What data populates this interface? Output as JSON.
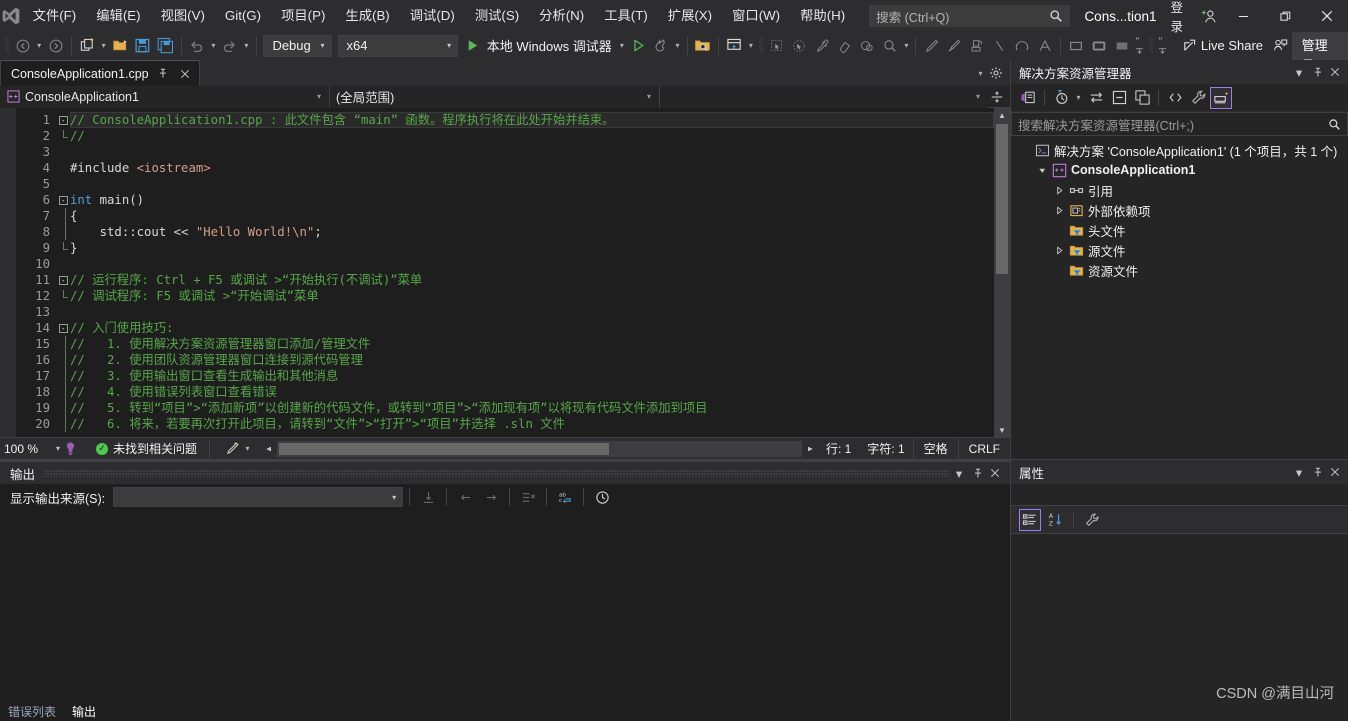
{
  "titlebar": {
    "logo_icon": "visual-studio-logo-icon",
    "menus": [
      {
        "label": "文件(F)"
      },
      {
        "label": "编辑(E)"
      },
      {
        "label": "视图(V)"
      },
      {
        "label": "Git(G)"
      },
      {
        "label": "项目(P)"
      },
      {
        "label": "生成(B)"
      },
      {
        "label": "调试(D)"
      },
      {
        "label": "测试(S)"
      },
      {
        "label": "分析(N)"
      },
      {
        "label": "工具(T)"
      },
      {
        "label": "扩展(X)"
      },
      {
        "label": "窗口(W)"
      },
      {
        "label": "帮助(H)"
      }
    ],
    "search_placeholder": "搜索 (Ctrl+Q)",
    "search_icon": "search-icon",
    "window_title": "Cons...tion1",
    "signin_label": "登录",
    "signin_icon": "add-person-icon",
    "minimize": "—",
    "restore": "❐",
    "close": "✕"
  },
  "toolbar": {
    "back_icon": "navigate-back-icon",
    "forward_icon": "navigate-forward-icon",
    "new_project_icon": "new-project-icon",
    "open_icon": "open-file-icon",
    "save_icon": "save-icon",
    "save_all_icon": "save-all-icon",
    "undo_icon": "undo-icon",
    "redo_icon": "redo-icon",
    "config_value": "Debug",
    "platform_value": "x64",
    "run_label": "本地 Windows 调试器",
    "run_icon": "play-icon",
    "start_no_debug_icon": "play-outline-icon",
    "hot_reload_icon": "hot-reload-icon",
    "folder_search_icon": "folder-search-icon",
    "window_layout_icon": "window-layout-icon",
    "select_icon": "select-tool-icon",
    "pointer_icon": "pointer-tool-icon",
    "eyedropper_icon": "eyedropper-icon",
    "eraser_icon": "eraser-icon",
    "fill_icon": "fill-icon",
    "zoom_icon": "magnifier-icon",
    "pencil_icon": "pencil-icon",
    "brush_icon": "brush-icon",
    "stamp_icon": "stamp-icon",
    "line_icon": "line-icon",
    "arc_icon": "arc-icon",
    "text_icon": "text-tool-icon",
    "rect1_icon": "rectangle-icon",
    "rect2_icon": "rounded-rectangle-icon",
    "rect3_icon": "filled-rectangle-icon",
    "quote_left_icon": "quote-left-icon",
    "quote_right_icon": "quote-right-icon",
    "live_share_label": "Live Share",
    "live_share_icon": "live-share-icon",
    "feedback_icon": "feedback-icon",
    "admin_label": "管理员"
  },
  "editor": {
    "tab_label": "ConsoleApplication1.cpp",
    "tab_pin_icon": "pin-icon",
    "tab_close_icon": "close-icon",
    "tab_settings_icon": "gear-icon",
    "tab_chevron_icon": "chevron-down-icon",
    "scope_left": "ConsoleApplication1",
    "scope_left_icon": "cpp-project-icon",
    "scope_right": "(全局范围)",
    "nav_split_icon": "split-window-icon",
    "code_lines": [
      {
        "n": 1,
        "fold": "open",
        "segs": [
          {
            "c": "cmt",
            "t": "// ConsoleApplication1.cpp : 此文件包含 “main” 函数。程序执行将在此处开始并结束。"
          }
        ]
      },
      {
        "n": 2,
        "fold": "end",
        "segs": [
          {
            "c": "cmt",
            "t": "//"
          }
        ]
      },
      {
        "n": 3,
        "fold": "",
        "segs": []
      },
      {
        "n": 4,
        "fold": "",
        "segs": [
          {
            "c": "pp",
            "t": "#include "
          },
          {
            "c": "str",
            "t": "<iostream>"
          }
        ]
      },
      {
        "n": 5,
        "fold": "",
        "segs": []
      },
      {
        "n": 6,
        "fold": "open",
        "segs": [
          {
            "c": "kw",
            "t": "int"
          },
          {
            "c": "id",
            "t": " main()"
          }
        ]
      },
      {
        "n": 7,
        "fold": "bar",
        "segs": [
          {
            "c": "id",
            "t": "{"
          }
        ]
      },
      {
        "n": 8,
        "fold": "dbar",
        "segs": [
          {
            "c": "id",
            "t": "    std::cout << "
          },
          {
            "c": "str",
            "t": "\"Hello World!\\n\""
          },
          {
            "c": "id",
            "t": ";"
          }
        ]
      },
      {
        "n": 9,
        "fold": "end",
        "segs": [
          {
            "c": "id",
            "t": "}"
          }
        ]
      },
      {
        "n": 10,
        "fold": "",
        "segs": []
      },
      {
        "n": 11,
        "fold": "open",
        "segs": [
          {
            "c": "cmt",
            "t": "// 运行程序: Ctrl + F5 或调试 >“开始执行(不调试)”菜单"
          }
        ]
      },
      {
        "n": 12,
        "fold": "end",
        "segs": [
          {
            "c": "cmt",
            "t": "// 调试程序: F5 或调试 >“开始调试”菜单"
          }
        ]
      },
      {
        "n": 13,
        "fold": "",
        "segs": []
      },
      {
        "n": 14,
        "fold": "open",
        "segs": [
          {
            "c": "cmt",
            "t": "// 入门使用技巧: "
          }
        ]
      },
      {
        "n": 15,
        "fold": "bar",
        "segs": [
          {
            "c": "cmt",
            "t": "//   1. 使用解决方案资源管理器窗口添加/管理文件"
          }
        ]
      },
      {
        "n": 16,
        "fold": "bar",
        "segs": [
          {
            "c": "cmt",
            "t": "//   2. 使用团队资源管理器窗口连接到源代码管理"
          }
        ]
      },
      {
        "n": 17,
        "fold": "bar",
        "segs": [
          {
            "c": "cmt",
            "t": "//   3. 使用输出窗口查看生成输出和其他消息"
          }
        ]
      },
      {
        "n": 18,
        "fold": "bar",
        "segs": [
          {
            "c": "cmt",
            "t": "//   4. 使用错误列表窗口查看错误"
          }
        ]
      },
      {
        "n": 19,
        "fold": "bar",
        "segs": [
          {
            "c": "cmt",
            "t": "//   5. 转到“项目”>“添加新项”以创建新的代码文件，或转到“项目”>“添加现有项”以将现有代码文件添加到项目"
          }
        ]
      },
      {
        "n": 20,
        "fold": "bar",
        "segs": [
          {
            "c": "cmt",
            "t": "//   6. 将来，若要再次打开此项目，请转到“文件”>“打开”>“项目”并选择 .sln 文件"
          }
        ]
      }
    ],
    "status": {
      "zoom": "100 %",
      "zoom_caret_icon": "chevron-down-icon",
      "intellisense_icon": "intellisense-icon",
      "issues_text": "未找到相关问题",
      "issues_ok_icon": "check-circle-icon",
      "pen_icon": "pen-tool-icon",
      "pen_caret_icon": "chevron-down-icon",
      "line_label": "行: 1",
      "col_label": "字符: 1",
      "spaces_label": "空格",
      "eol_label": "CRLF"
    }
  },
  "output": {
    "title": "输出",
    "chevron_icon": "chevron-down-icon",
    "pin_icon": "pin-icon",
    "close_icon": "close-icon",
    "source_label": "显示输出来源(S):",
    "source_value": "",
    "source_caret_icon": "chevron-down-icon",
    "buttons": [
      {
        "icon": "find-message-icon"
      },
      {
        "icon": "go-previous-icon"
      },
      {
        "icon": "go-next-icon"
      },
      {
        "icon": "clear-all-icon"
      },
      {
        "icon": "word-wrap-icon"
      },
      {
        "icon": "toggle-timestamp-icon"
      }
    ],
    "bottom_tabs": [
      {
        "label": "错误列表",
        "active": false
      },
      {
        "label": "输出",
        "active": true
      }
    ]
  },
  "solution_explorer": {
    "title": "解决方案资源管理器",
    "chevron_icon": "chevron-down-icon",
    "pin_icon": "pin-icon",
    "close_icon": "close-icon",
    "toolbar": [
      {
        "icon": "solution-explorer-home-icon",
        "selected": false
      },
      {
        "icon": "pending-changes-icon",
        "selected": false
      },
      {
        "icon": "sync-with-active-document-icon",
        "selected": false
      },
      {
        "icon": "collapse-all-icon",
        "selected": false
      },
      {
        "icon": "refresh-icon",
        "selected": false
      },
      {
        "icon": "show-all-files-icon",
        "selected": false
      },
      {
        "icon": "properties-wrench-icon",
        "selected": false
      },
      {
        "icon": "preview-selected-items-icon",
        "selected": true
      }
    ],
    "search_placeholder": "搜索解决方案资源管理器(Ctrl+;)",
    "search_icon": "search-icon",
    "tree": [
      {
        "depth": 0,
        "twisty": "",
        "icon": "solution-icon",
        "label": "解决方案 'ConsoleApplication1' (1 个项目，共 1 个)",
        "bold": false
      },
      {
        "depth": 1,
        "twisty": "expanded",
        "icon": "cpp-project-icon",
        "label": "ConsoleApplication1",
        "bold": true
      },
      {
        "depth": 2,
        "twisty": "collapsed",
        "icon": "references-icon",
        "label": "引用",
        "bold": false
      },
      {
        "depth": 2,
        "twisty": "collapsed",
        "icon": "external-deps-icon",
        "label": "外部依赖项",
        "bold": false
      },
      {
        "depth": 2,
        "twisty": "",
        "icon": "filter-folder-icon",
        "label": "头文件",
        "bold": false
      },
      {
        "depth": 2,
        "twisty": "collapsed",
        "icon": "filter-folder-icon",
        "label": "源文件",
        "bold": false
      },
      {
        "depth": 2,
        "twisty": "",
        "icon": "filter-folder-icon",
        "label": "资源文件",
        "bold": false
      }
    ]
  },
  "properties": {
    "title": "属性",
    "chevron_icon": "chevron-down-icon",
    "pin_icon": "pin-icon",
    "close_icon": "close-icon",
    "toolbar": [
      {
        "icon": "categorized-icon",
        "selected": true
      },
      {
        "icon": "alphabetical-sort-icon",
        "selected": false
      },
      {
        "icon": "property-pages-icon",
        "selected": false
      }
    ]
  },
  "watermark": "CSDN @满目山河",
  "colors": {
    "accent": "#007acc",
    "chrome": "#2d2d30",
    "panel": "#252526",
    "editor_bg": "#1e1e1e",
    "comment": "#57a64a",
    "keyword": "#569cd6",
    "string": "#d69d85",
    "selection_border": "#9a7ee6",
    "ok_green": "#4ec94e"
  }
}
